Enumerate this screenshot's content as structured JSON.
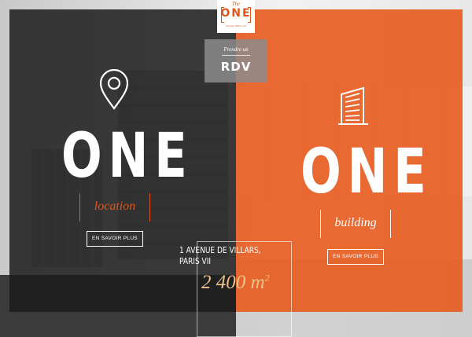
{
  "logo": {
    "the": "The",
    "one": "ONE",
    "subtitle": "Premier Office Loft"
  },
  "rdv": {
    "prefix": "Prendre un",
    "label": "RDV"
  },
  "left_panel": {
    "title": "ONE",
    "bracket_label": "location",
    "button_label": "EN SAVOIR PLUS",
    "icon": "map-pin-icon"
  },
  "right_panel": {
    "title": "ONE",
    "bracket_label": "building",
    "button_label": "EN SAVOIR PLUS",
    "icon": "building-icon"
  },
  "address": {
    "line1": "1 AVENUE DE VILLARS,",
    "line2": "PARIS VII"
  },
  "area": {
    "value": "2 400 m",
    "exponent": "2"
  },
  "colors": {
    "accent": "#e85a1e",
    "dark": "#1c1c1c",
    "area_text": "#f0c28a"
  }
}
